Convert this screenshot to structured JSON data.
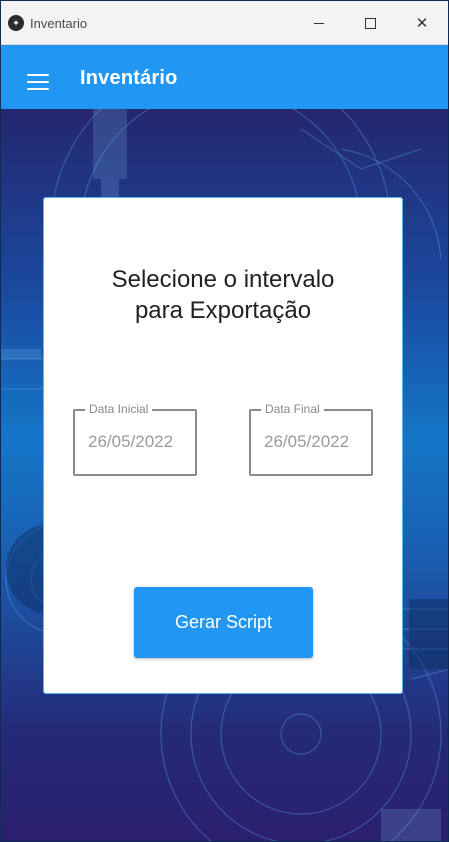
{
  "window": {
    "title": "Inventario",
    "icon": "kivy-icon",
    "controls": {
      "minimize": "minimize-icon",
      "maximize": "maximize-icon",
      "close": "close-icon"
    },
    "close_glyph": "✕"
  },
  "appbar": {
    "title": "Inventário",
    "menu_icon": "hamburger-menu-icon",
    "color": "#2196f3"
  },
  "card": {
    "title_line1": "Selecione o intervalo",
    "title_line2": "para Exportação",
    "fields": [
      {
        "label": "Data Inicial",
        "value": "26/05/2022"
      },
      {
        "label": "Data Final",
        "value": "26/05/2022"
      }
    ],
    "button_label": "Gerar Script"
  },
  "colors": {
    "accent": "#2196f3",
    "field_border": "#8a8a8a",
    "background_top": "#24266e",
    "background_mid": "#1576c8"
  }
}
